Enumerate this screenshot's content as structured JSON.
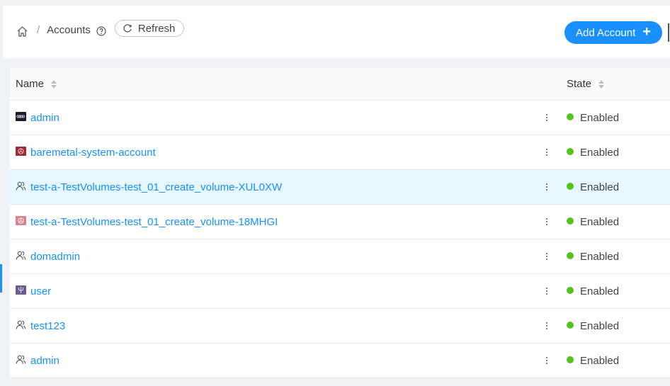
{
  "breadcrumb": {
    "home_icon": "home-icon",
    "separator": "/",
    "title": "Accounts",
    "help_icon": "question-circle-icon"
  },
  "toolbar": {
    "refresh_label": "Refresh",
    "refresh_icon": "reload-icon",
    "add_label": "Add Account",
    "add_icon": "plus-icon"
  },
  "table": {
    "columns": [
      {
        "label": "Name",
        "sortable": true
      },
      {
        "label": "State",
        "sortable": true
      }
    ],
    "rows": [
      {
        "name": "admin",
        "icon": "avatar-audi-icon",
        "state": "Enabled",
        "highlighted": false
      },
      {
        "name": "baremetal-system-account",
        "icon": "avatar-red-emblem-icon",
        "state": "Enabled",
        "highlighted": false
      },
      {
        "name": "test-a-TestVolumes-test_01_create_volume-XUL0XW",
        "icon": "user-group-icon",
        "state": "Enabled",
        "highlighted": true
      },
      {
        "name": "test-a-TestVolumes-test_01_create_volume-18MHGI",
        "icon": "avatar-pink-emblem-icon",
        "state": "Enabled",
        "highlighted": false
      },
      {
        "name": "domadmin",
        "icon": "user-group-icon",
        "state": "Enabled",
        "highlighted": false
      },
      {
        "name": "user",
        "icon": "avatar-trident-icon",
        "state": "Enabled",
        "highlighted": false
      },
      {
        "name": "test123",
        "icon": "user-group-icon",
        "state": "Enabled",
        "highlighted": false
      },
      {
        "name": "admin",
        "icon": "user-group-icon",
        "state": "Enabled",
        "highlighted": false
      }
    ]
  },
  "colors": {
    "accent": "#1890ff",
    "enabled": "#52c41a",
    "highlight_row": "#e6f7ff"
  }
}
